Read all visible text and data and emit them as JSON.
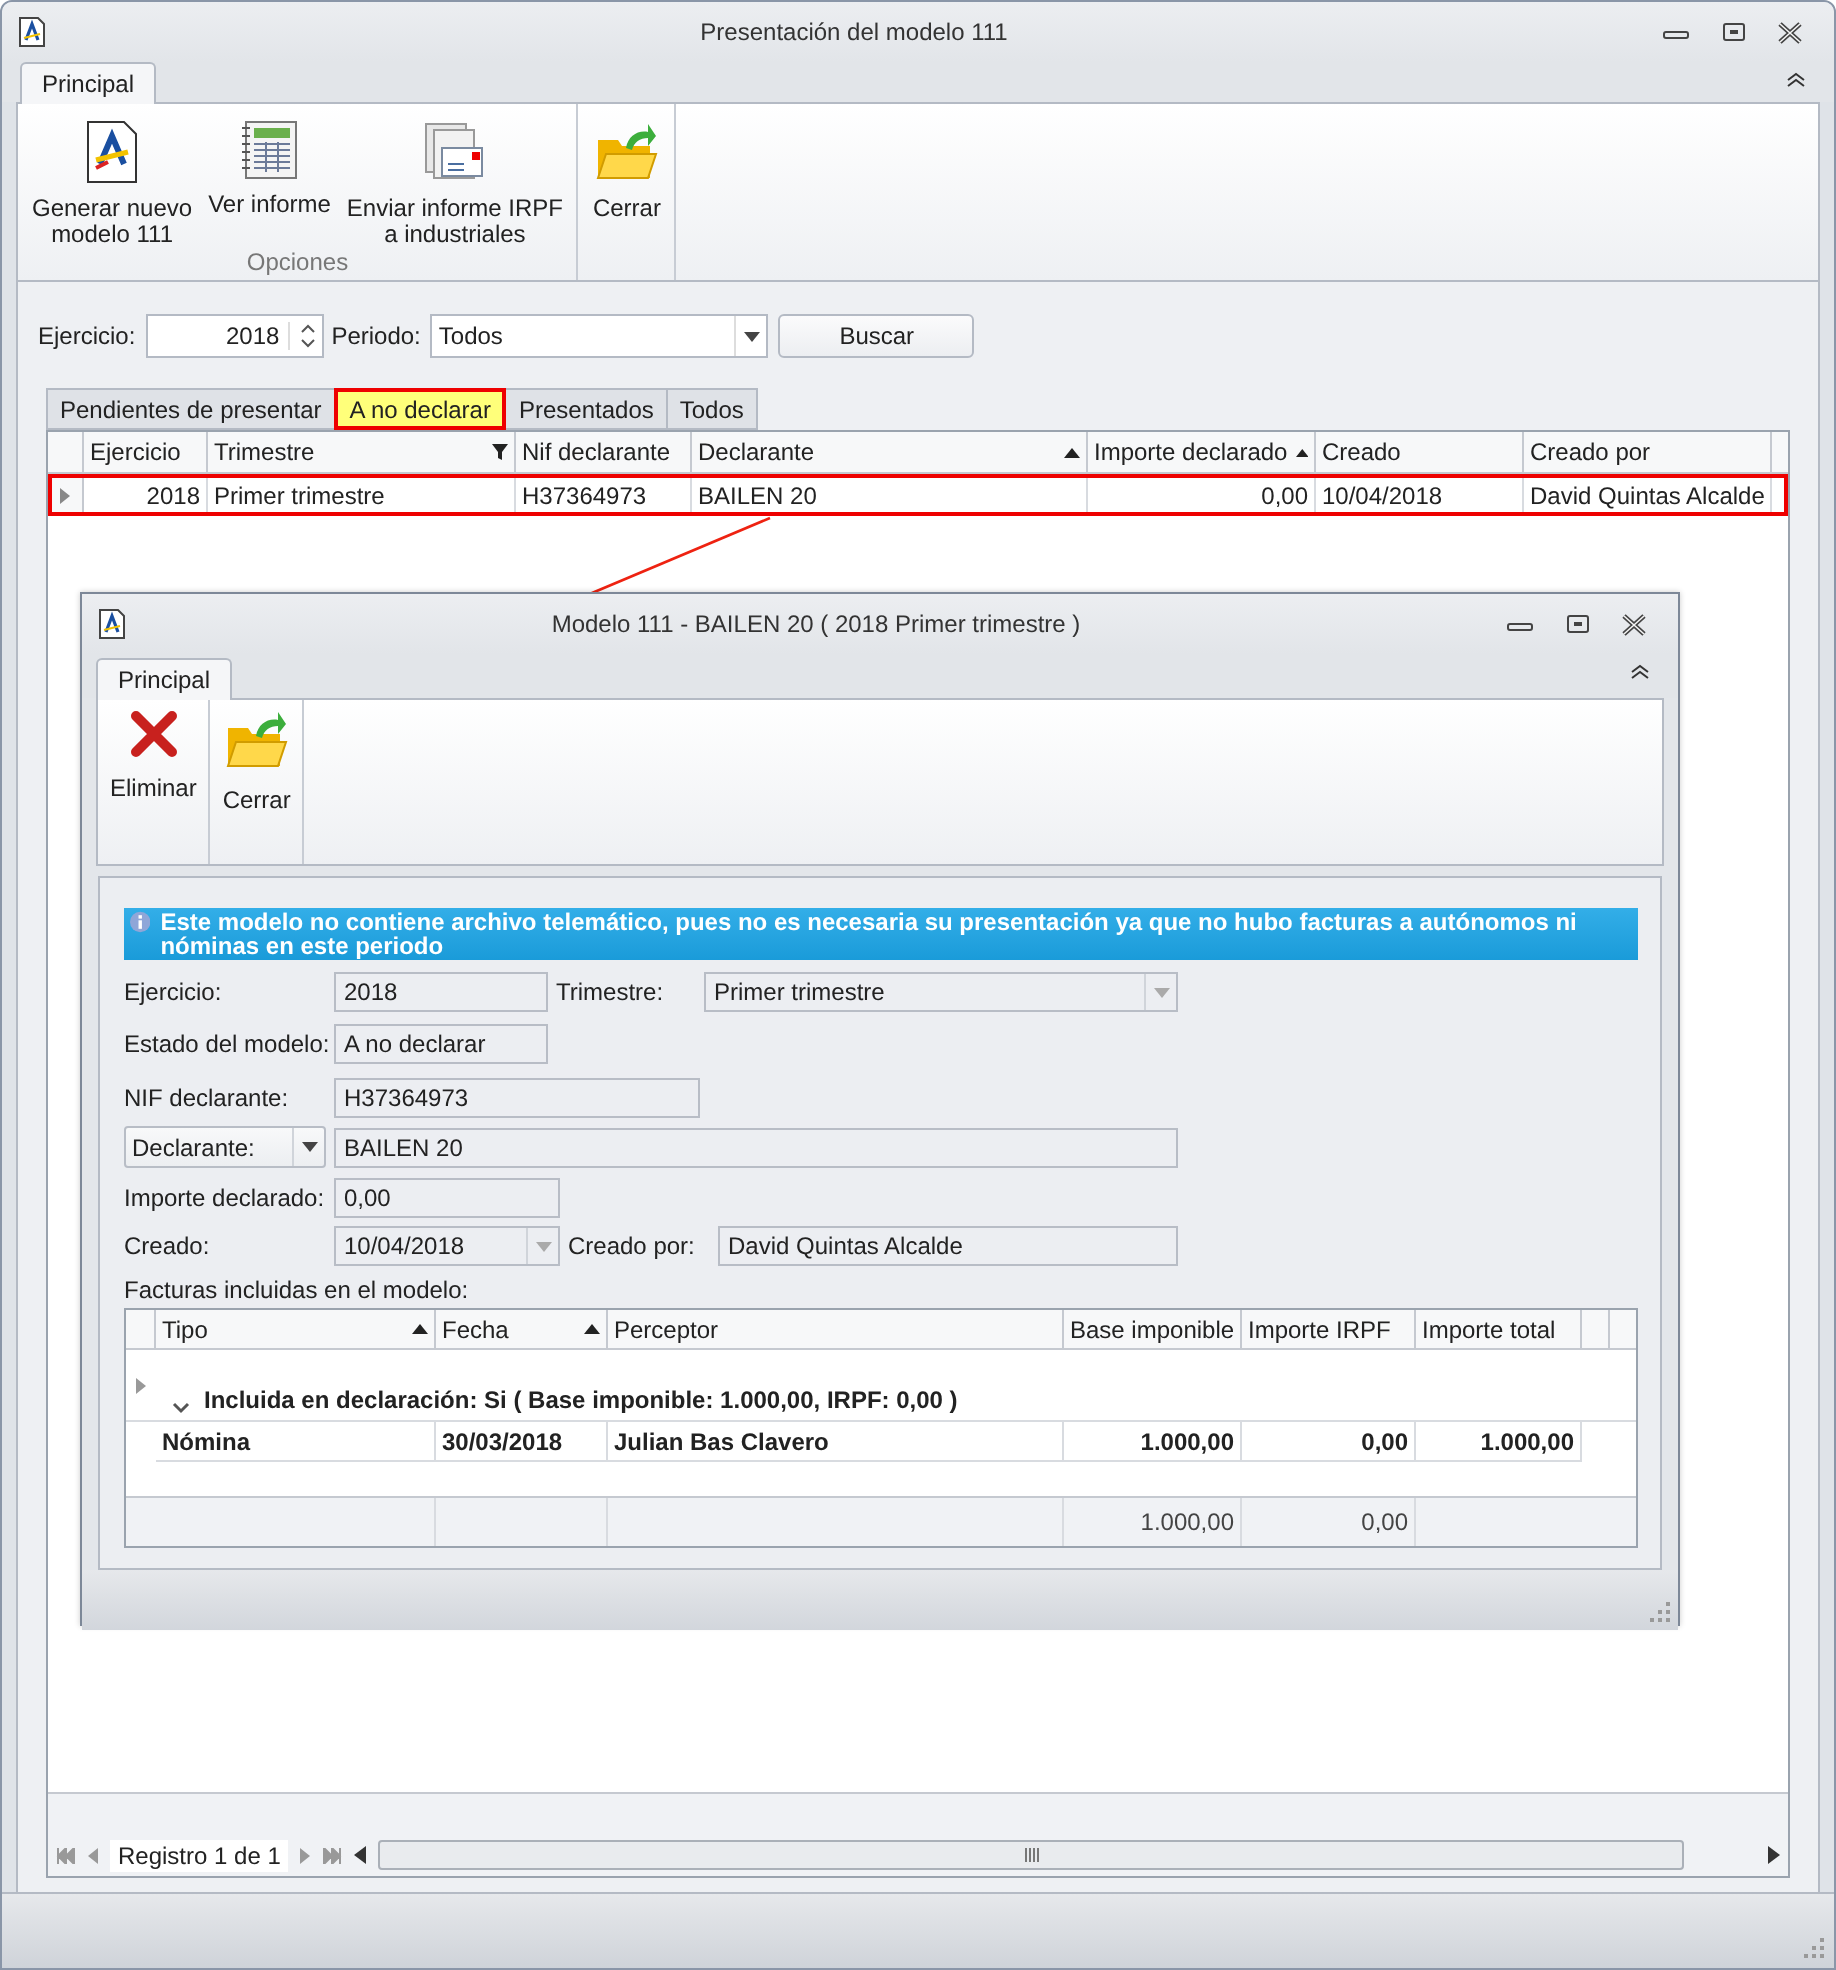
{
  "window": {
    "title": "Presentación del modelo 111"
  },
  "ribbon": {
    "tabs": [
      {
        "label": "Principal",
        "selected": true
      }
    ],
    "groups": [
      {
        "label": "Opciones",
        "buttons": [
          {
            "label": "Generar nuevo\nmodelo 111"
          },
          {
            "label": "Ver informe"
          },
          {
            "label": "Enviar informe IRPF\na industriales"
          }
        ]
      },
      {
        "buttons": [
          {
            "label": "Cerrar"
          }
        ]
      }
    ]
  },
  "filters": {
    "ejercicio": {
      "label": "Ejercicio:",
      "value": "2018"
    },
    "periodo": {
      "label": "Periodo:",
      "value": "Todos"
    },
    "search_button": "Buscar"
  },
  "view_tabs": [
    {
      "label": "Pendientes de presentar",
      "selected": false
    },
    {
      "label": "A no declarar",
      "selected": true
    },
    {
      "label": "Presentados",
      "selected": false
    },
    {
      "label": "Todos",
      "selected": false
    }
  ],
  "grid": {
    "columns": [
      {
        "label": "Ejercicio",
        "kind": "number",
        "sorted": false,
        "filtered": false
      },
      {
        "label": "Trimestre",
        "kind": "text",
        "sorted": false,
        "filtered": true
      },
      {
        "label": "Nif declarante",
        "kind": "text",
        "sorted": false,
        "filtered": false
      },
      {
        "label": "Declarante",
        "kind": "text",
        "sorted": true,
        "filtered": false
      },
      {
        "label": "Importe declarado",
        "kind": "number",
        "sorted": true,
        "filtered": false
      },
      {
        "label": "Creado",
        "kind": "text",
        "sorted": false,
        "filtered": false
      },
      {
        "label": "Creado por",
        "kind": "text",
        "sorted": false,
        "filtered": false
      }
    ],
    "rows": [
      {
        "selected": true,
        "cells": [
          "2018",
          "Primer trimestre",
          "H37364973",
          "BAILEN 20",
          "0,00",
          "10/04/2018",
          "David Quintas Alcalde"
        ]
      }
    ]
  },
  "pager": {
    "text": "Registro 1 de 1"
  },
  "dialog": {
    "title": "Modelo 111 - BAILEN 20 ( 2018 Primer trimestre )",
    "ribbon_tabs": [
      {
        "label": "Principal",
        "selected": true
      }
    ],
    "buttons": [
      {
        "label": "Eliminar"
      },
      {
        "label": "Cerrar"
      }
    ],
    "info": "Este modelo no contiene archivo telemático, pues no es necesaria su presentación ya que no hubo facturas a autónomos ni nóminas en este periodo",
    "form": {
      "ejercicio": {
        "label": "Ejercicio:",
        "value": "2018"
      },
      "trimestre": {
        "label": "Trimestre:",
        "value": "Primer trimestre"
      },
      "estado": {
        "label": "Estado del modelo:",
        "value": "A no declarar"
      },
      "nif": {
        "label": "NIF declarante:",
        "value": "H37364973"
      },
      "declarante": {
        "label": "Declarante:",
        "value": "BAILEN 20"
      },
      "importe": {
        "label": "Importe declarado:",
        "value": "0,00"
      },
      "creado": {
        "label": "Creado:",
        "value": "10/04/2018"
      },
      "creado_por": {
        "label": "Creado por:",
        "value": "David Quintas Alcalde"
      },
      "invoices_label": "Facturas incluidas en el modelo:"
    },
    "invoices": {
      "columns": [
        {
          "label": "Tipo",
          "kind": "text",
          "sorted": true
        },
        {
          "label": "Fecha",
          "kind": "text",
          "sorted": true
        },
        {
          "label": "Perceptor",
          "kind": "text",
          "sorted": false
        },
        {
          "label": "Base imponible",
          "kind": "number",
          "sorted": false,
          "total": "1.000,00"
        },
        {
          "label": "Importe IRPF",
          "kind": "number",
          "sorted": false,
          "total": "0,00"
        },
        {
          "label": "Importe total",
          "kind": "number",
          "sorted": false
        }
      ],
      "group": {
        "label": "Incluida en declaración: Si ( Base imponible: 1.000,00,  IRPF: 0,00 )",
        "expanded": true,
        "selected": true
      },
      "rows": [
        {
          "selected": false,
          "cells": [
            "Nómina",
            "30/03/2018",
            "Julian Bas Clavero",
            "1.000,00",
            "0,00",
            "1.000,00"
          ]
        }
      ]
    }
  }
}
